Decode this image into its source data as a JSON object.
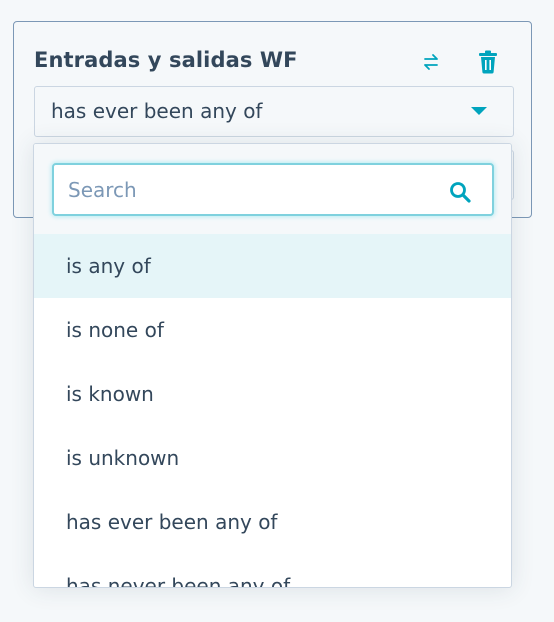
{
  "filter_card": {
    "title": "Entradas y salidas WF",
    "swap_icon": "swap-arrows-icon",
    "delete_icon": "trash-icon",
    "operator_select": {
      "value": "has ever been any of"
    }
  },
  "dropdown": {
    "search": {
      "placeholder": "Search",
      "value": ""
    },
    "options": [
      {
        "label": "is any of",
        "highlighted": true
      },
      {
        "label": "is none of",
        "highlighted": false
      },
      {
        "label": "is known",
        "highlighted": false
      },
      {
        "label": "is unknown",
        "highlighted": false
      },
      {
        "label": "has ever been any of",
        "highlighted": false
      },
      {
        "label": "has never been any of",
        "highlighted": false
      }
    ]
  },
  "colors": {
    "accent": "#00a4bd",
    "text": "#33475b",
    "highlight_bg": "#e5f5f8",
    "border": "#cbd6e2"
  }
}
